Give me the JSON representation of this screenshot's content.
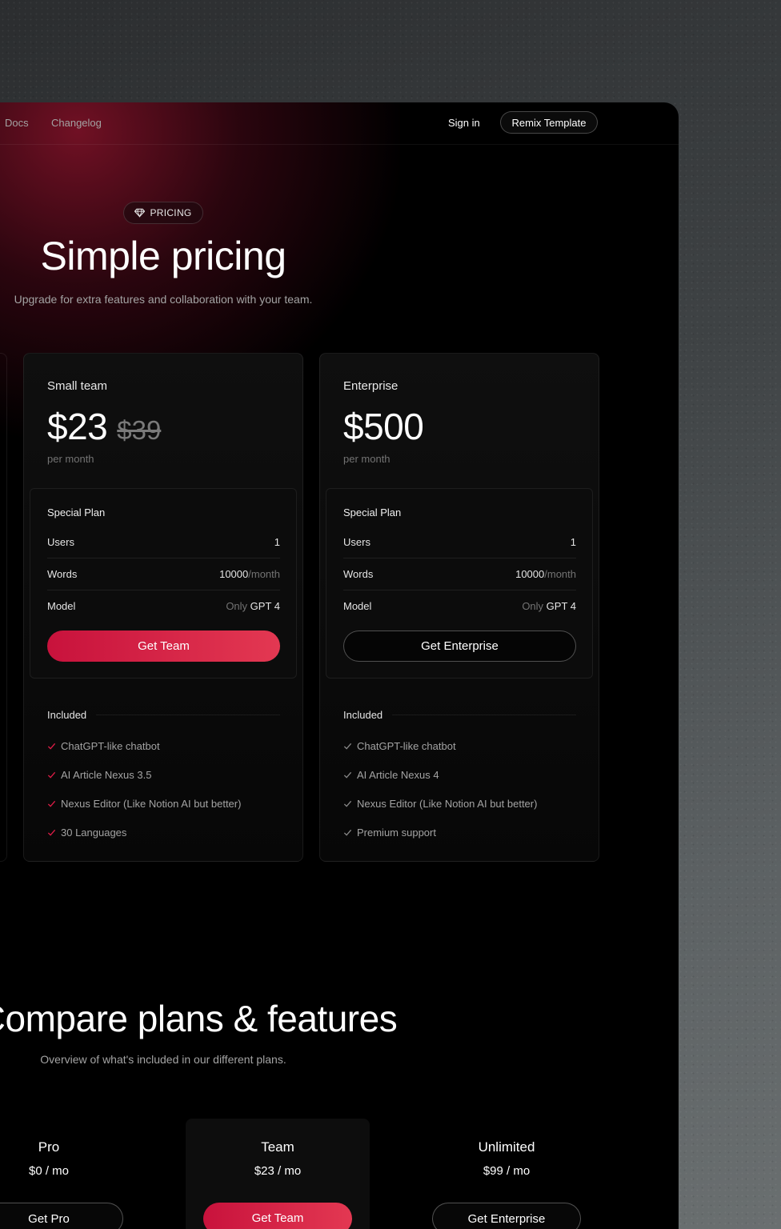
{
  "nav": {
    "links": [
      "Docs",
      "Changelog"
    ],
    "sign_in": "Sign in",
    "cta": "Remix Template"
  },
  "hero": {
    "badge": "PRICING",
    "badge_icon": "gem-icon",
    "title": "Simple pricing",
    "subtitle": "Upgrade for extra features and collaboration with your team."
  },
  "plans": [
    {
      "name": "Small team",
      "price": "$23",
      "old_price": "$39",
      "period": "per month",
      "box_title": "Special Plan",
      "rows": [
        {
          "label": "Users",
          "value": "1",
          "prefix": "",
          "suffix": ""
        },
        {
          "label": "Words",
          "value": "10000",
          "prefix": "",
          "suffix": "/month"
        },
        {
          "label": "Model",
          "value": "GPT 4",
          "prefix": "Only ",
          "suffix": ""
        }
      ],
      "cta": "Get Team",
      "included_label": "Included",
      "features": [
        "ChatGPT-like chatbot",
        "AI Article Nexus 3.5",
        "Nexus Editor (Like Notion AI but better)",
        "30 Languages"
      ]
    },
    {
      "name": "Enterprise",
      "price": "$500",
      "old_price": "",
      "period": "per month",
      "box_title": "Special Plan",
      "rows": [
        {
          "label": "Users",
          "value": "1",
          "prefix": "",
          "suffix": ""
        },
        {
          "label": "Words",
          "value": "10000",
          "prefix": "",
          "suffix": "/month"
        },
        {
          "label": "Model",
          "value": "GPT 4",
          "prefix": "Only ",
          "suffix": ""
        }
      ],
      "cta": "Get Enterprise",
      "included_label": "Included",
      "features": [
        "ChatGPT-like chatbot",
        "AI Article Nexus 4",
        "Nexus Editor (Like Notion AI but better)",
        "Premium support"
      ]
    }
  ],
  "compare": {
    "title": "Compare plans & features",
    "subtitle": "Overview of what's included in our different plans.",
    "plans": [
      {
        "name": "Pro",
        "price": "$0 / mo",
        "cta": "Get Pro"
      },
      {
        "name": "Team",
        "price": "$23 / mo",
        "cta": "Get Team"
      },
      {
        "name": "Unlimited",
        "price": "$99 / mo",
        "cta": "Get Enterprise"
      }
    ]
  },
  "colors": {
    "accent": "#e11d48",
    "accent_light": "#e33852",
    "check_team": "#e11d48",
    "check_enterprise": "#8a8a8a"
  }
}
